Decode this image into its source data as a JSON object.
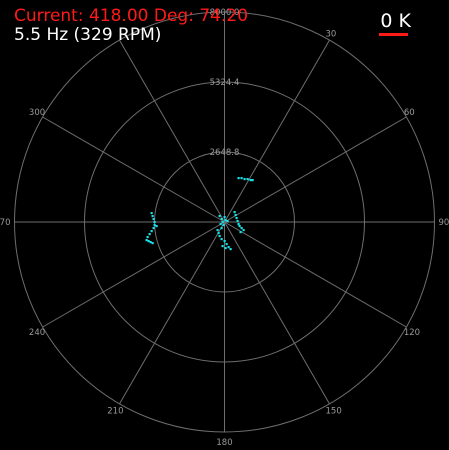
{
  "status": {
    "current_label": "Current:",
    "current_value": "418.00",
    "deg_label": "Deg:",
    "deg_value": "74.20",
    "text": "Current: 418.00 Deg: 74.20"
  },
  "frequency": "5.5 Hz (329 RPM)",
  "k_indicator": "0 K",
  "radial_labels": [
    "8000.0",
    "5324.4",
    "2648.8"
  ],
  "angle_labels": [
    "30",
    "60",
    "90",
    "120",
    "150",
    "180",
    "210",
    "240",
    "270",
    "300"
  ],
  "colors": {
    "background": "#000000",
    "grid": "#6e6e6e",
    "points": "#19e0e6",
    "status_text": "#ff1a1a",
    "info_text": "#ffffff"
  },
  "scan_points_dx_dy": [
    [
      14,
      -44
    ],
    [
      17,
      -44
    ],
    [
      20,
      -43
    ],
    [
      23,
      -43
    ],
    [
      26,
      -42
    ],
    [
      28,
      -42
    ],
    [
      -73,
      -9
    ],
    [
      -72,
      -6
    ],
    [
      -71,
      -3
    ],
    [
      -70,
      0
    ],
    [
      -70,
      3
    ],
    [
      -68,
      4
    ],
    [
      -71,
      6
    ],
    [
      -73,
      9
    ],
    [
      -75,
      12
    ],
    [
      -77,
      15
    ],
    [
      -78,
      18
    ],
    [
      -76,
      19
    ],
    [
      -74,
      20
    ],
    [
      -72,
      21
    ],
    [
      -5,
      -6
    ],
    [
      -3,
      -3
    ],
    [
      -2,
      0
    ],
    [
      -4,
      2
    ],
    [
      0,
      -5
    ],
    [
      1,
      -2
    ],
    [
      3,
      -1
    ],
    [
      -1,
      3
    ],
    [
      -3,
      6
    ],
    [
      10,
      -10
    ],
    [
      11,
      -7
    ],
    [
      12,
      -4
    ],
    [
      13,
      -1
    ],
    [
      14,
      2
    ],
    [
      15,
      4
    ],
    [
      17,
      6
    ],
    [
      19,
      8
    ],
    [
      16,
      10
    ],
    [
      -7,
      8
    ],
    [
      -6,
      11
    ],
    [
      -5,
      14
    ],
    [
      -3,
      17
    ],
    [
      0,
      19
    ],
    [
      2,
      22
    ],
    [
      4,
      25
    ],
    [
      6,
      27
    ],
    [
      -2,
      24
    ],
    [
      1,
      26
    ]
  ]
}
